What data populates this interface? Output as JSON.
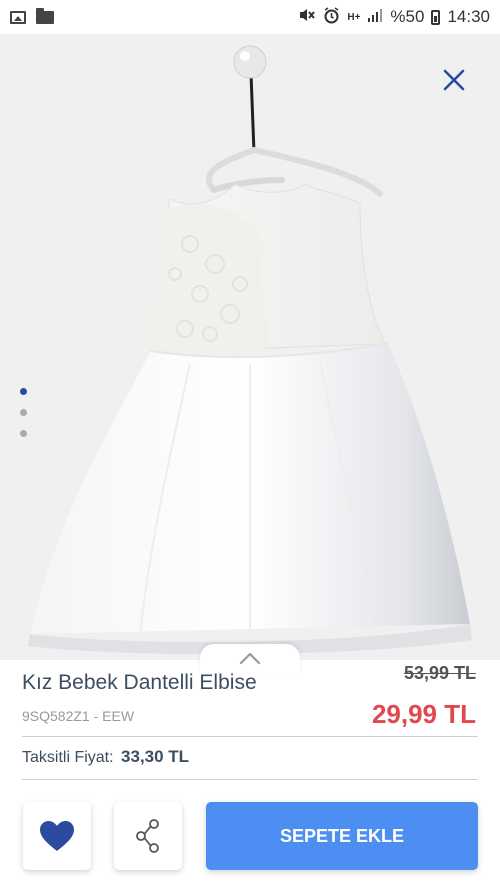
{
  "status_bar": {
    "battery": "%50",
    "time": "14:30",
    "network": "H+",
    "icons": [
      "image-icon",
      "folder-icon",
      "mute-icon",
      "alarm-icon",
      "signal-icon",
      "battery-icon"
    ]
  },
  "gallery": {
    "image_count": 3,
    "active_index": 0,
    "icons": [
      "close-icon",
      "chevron-up-icon"
    ]
  },
  "product": {
    "title": "Kız Bebek Dantelli Elbise",
    "code": "9SQ582Z1 - EEW",
    "old_price": "53,99 TL",
    "new_price": "29,99 TL",
    "installment_label": "Taksitli Fiyat:",
    "installment_value": "33,30 TL"
  },
  "actions": {
    "add_to_cart": "SEPETE EKLE",
    "icons": [
      "heart-icon",
      "share-icon"
    ]
  },
  "colors": {
    "accent_blue": "#4d8ef2",
    "heart_blue": "#2b4aa0",
    "price_red": "#e0484e",
    "close_blue": "#2b4aa0"
  }
}
